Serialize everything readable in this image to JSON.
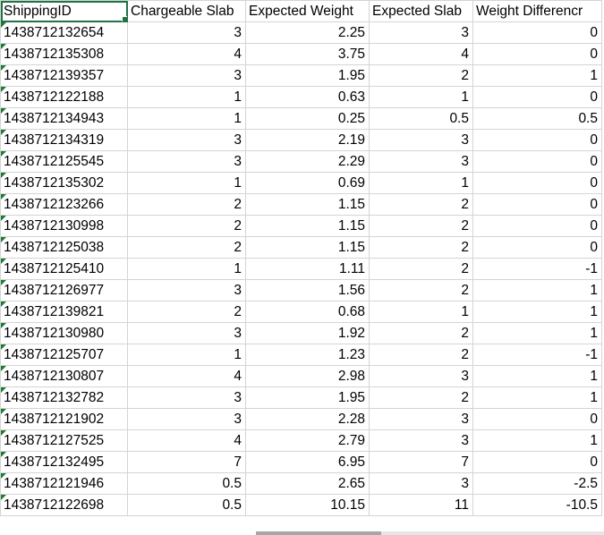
{
  "columns": [
    "ShippingID",
    "Chargeable Slab",
    "Expected Weight",
    "Expected Slab",
    "Weight Differencr"
  ],
  "rows": [
    [
      "1438712132654",
      "3",
      "2.25",
      "3",
      "0"
    ],
    [
      "1438712135308",
      "4",
      "3.75",
      "4",
      "0"
    ],
    [
      "1438712139357",
      "3",
      "1.95",
      "2",
      "1"
    ],
    [
      "1438712122188",
      "1",
      "0.63",
      "1",
      "0"
    ],
    [
      "1438712134943",
      "1",
      "0.25",
      "0.5",
      "0.5"
    ],
    [
      "1438712134319",
      "3",
      "2.19",
      "3",
      "0"
    ],
    [
      "1438712125545",
      "3",
      "2.29",
      "3",
      "0"
    ],
    [
      "1438712135302",
      "1",
      "0.69",
      "1",
      "0"
    ],
    [
      "1438712123266",
      "2",
      "1.15",
      "2",
      "0"
    ],
    [
      "1438712130998",
      "2",
      "1.15",
      "2",
      "0"
    ],
    [
      "1438712125038",
      "2",
      "1.15",
      "2",
      "0"
    ],
    [
      "1438712125410",
      "1",
      "1.11",
      "2",
      "-1"
    ],
    [
      "1438712126977",
      "3",
      "1.56",
      "2",
      "1"
    ],
    [
      "1438712139821",
      "2",
      "0.68",
      "1",
      "1"
    ],
    [
      "1438712130980",
      "3",
      "1.92",
      "2",
      "1"
    ],
    [
      "1438712125707",
      "1",
      "1.23",
      "2",
      "-1"
    ],
    [
      "1438712130807",
      "4",
      "2.98",
      "3",
      "1"
    ],
    [
      "1438712132782",
      "3",
      "1.95",
      "2",
      "1"
    ],
    [
      "1438712121902",
      "3",
      "2.28",
      "3",
      "0"
    ],
    [
      "1438712127525",
      "4",
      "2.79",
      "3",
      "1"
    ],
    [
      "1438712132495",
      "7",
      "6.95",
      "7",
      "0"
    ],
    [
      "1438712121946",
      "0.5",
      "2.65",
      "3",
      "-2.5"
    ],
    [
      "1438712122698",
      "0.5",
      "10.15",
      "11",
      "-10.5"
    ]
  ],
  "colors": {
    "grid_line": "#d4d4d4",
    "selection": "#217346",
    "number_flag": "#1e7b34"
  }
}
